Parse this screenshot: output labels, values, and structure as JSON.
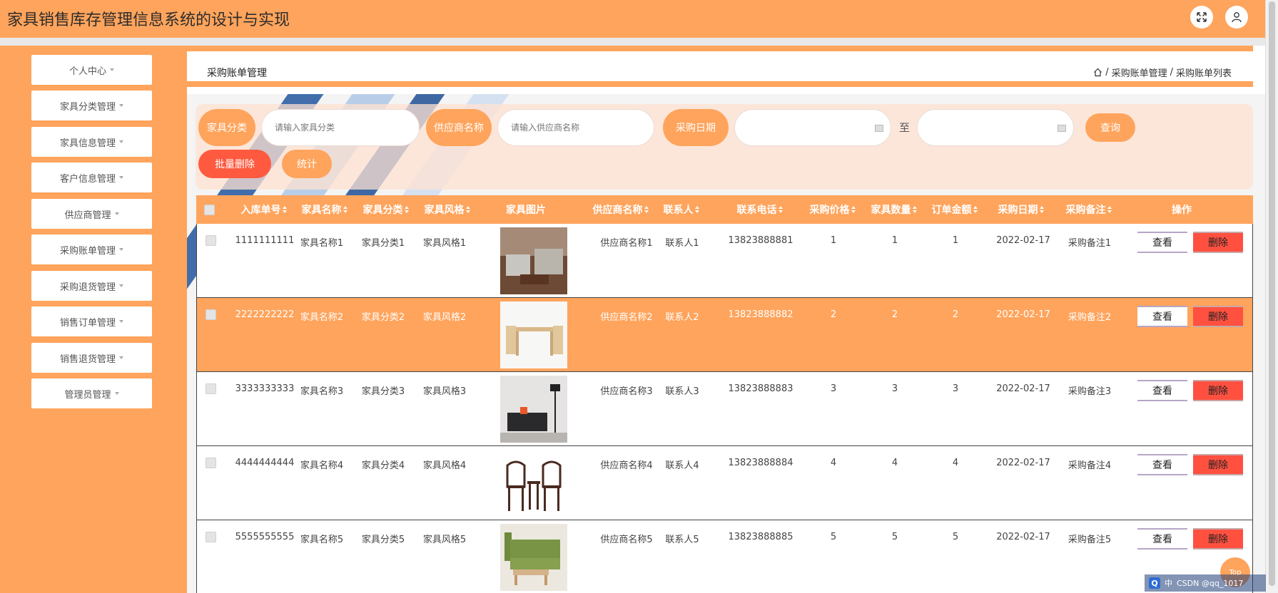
{
  "header": {
    "title": "家具销售库存管理信息系统的设计与实现",
    "fullscreen_icon": "expand-icon",
    "user_icon": "user-icon"
  },
  "sidebar": {
    "items": [
      {
        "label": "个人中心"
      },
      {
        "label": "家具分类管理"
      },
      {
        "label": "家具信息管理"
      },
      {
        "label": "客户信息管理"
      },
      {
        "label": "供应商管理"
      },
      {
        "label": "采购账单管理"
      },
      {
        "label": "采购退货管理"
      },
      {
        "label": "销售订单管理"
      },
      {
        "label": "销售退货管理"
      },
      {
        "label": "管理员管理"
      }
    ]
  },
  "page": {
    "title": "采购账单管理",
    "breadcrumb": [
      "采购账单管理",
      "采购账单列表"
    ],
    "breadcrumb_sep": "/"
  },
  "search": {
    "category_label": "家具分类",
    "category_placeholder": "请输入家具分类",
    "supplier_label": "供应商名称",
    "supplier_placeholder": "请输入供应商名称",
    "date_label": "采购日期",
    "to_label": "至",
    "query_button": "查询",
    "batch_delete_button": "批量删除",
    "stats_button": "统计"
  },
  "table": {
    "headers": [
      "入库单号",
      "家具名称",
      "家具分类",
      "家具风格",
      "家具图片",
      "供应商名称",
      "联系人",
      "联系电话",
      "采购价格",
      "家具数量",
      "订单金额",
      "采购日期",
      "采购备注",
      "操作"
    ],
    "view_label": "查看",
    "delete_label": "删除",
    "rows": [
      {
        "id": "1111111111",
        "name": "家具名称1",
        "category": "家具分类1",
        "style": "家具风格1",
        "image": "sofa-set",
        "supplier": "供应商名称1",
        "contact": "联系人1",
        "phone": "13823888881",
        "price": "1",
        "qty": "1",
        "amount": "1",
        "date": "2022-02-17",
        "note": "采购备注1"
      },
      {
        "id": "2222222222",
        "name": "家具名称2",
        "category": "家具分类2",
        "style": "家具风格2",
        "image": "dining-table",
        "supplier": "供应商名称2",
        "contact": "联系人2",
        "phone": "13823888882",
        "price": "2",
        "qty": "2",
        "amount": "2",
        "date": "2022-02-17",
        "note": "采购备注2"
      },
      {
        "id": "3333333333",
        "name": "家具名称3",
        "category": "家具分类3",
        "style": "家具风格3",
        "image": "black-sofa",
        "supplier": "供应商名称3",
        "contact": "联系人3",
        "phone": "13823888883",
        "price": "3",
        "qty": "3",
        "amount": "3",
        "date": "2022-02-17",
        "note": "采购备注3"
      },
      {
        "id": "4444444444",
        "name": "家具名称4",
        "category": "家具分类4",
        "style": "家具风格4",
        "image": "wooden-chairs",
        "supplier": "供应商名称4",
        "contact": "联系人4",
        "phone": "13823888884",
        "price": "4",
        "qty": "4",
        "amount": "4",
        "date": "2022-02-17",
        "note": "采购备注4"
      },
      {
        "id": "5555555555",
        "name": "家具名称5",
        "category": "家具分类5",
        "style": "家具风格5",
        "image": "green-sofa",
        "supplier": "供应商名称5",
        "contact": "联系人5",
        "phone": "13823888885",
        "price": "5",
        "qty": "5",
        "amount": "5",
        "date": "2022-02-17",
        "note": "采购备注5"
      }
    ]
  },
  "floating": {
    "top_button": "Top",
    "ime_text": "中",
    "ime_q": "Q",
    "watermark": "CSDN @qq_1017"
  },
  "colors": {
    "accent": "#ffa45c",
    "danger": "#ff5040"
  }
}
